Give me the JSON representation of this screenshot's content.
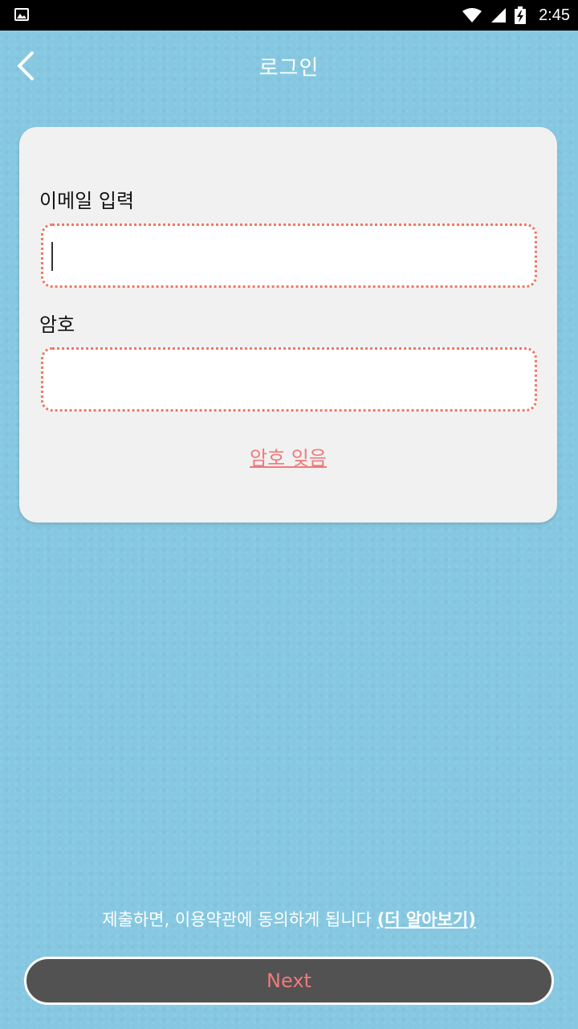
{
  "status_bar": {
    "time": "2:45",
    "icons": [
      "gallery-icon",
      "wifi-icon",
      "signal-icon",
      "battery-charging-icon"
    ]
  },
  "header": {
    "title": "로그인",
    "back_icon": "chevron-left-icon"
  },
  "form": {
    "email_label": "이메일 입력",
    "email_value": "",
    "password_label": "암호",
    "password_value": "",
    "forgot_password": "암호 잊음"
  },
  "footer": {
    "terms_text": "제출하면, 이용약관에 동의하게 됩니다",
    "learn_more": "(더 알아보기)",
    "next_label": "Next"
  },
  "colors": {
    "background": "#86c8e1",
    "card": "#f1f1f1",
    "accent": "#ef7a7a",
    "button": "#525252"
  }
}
